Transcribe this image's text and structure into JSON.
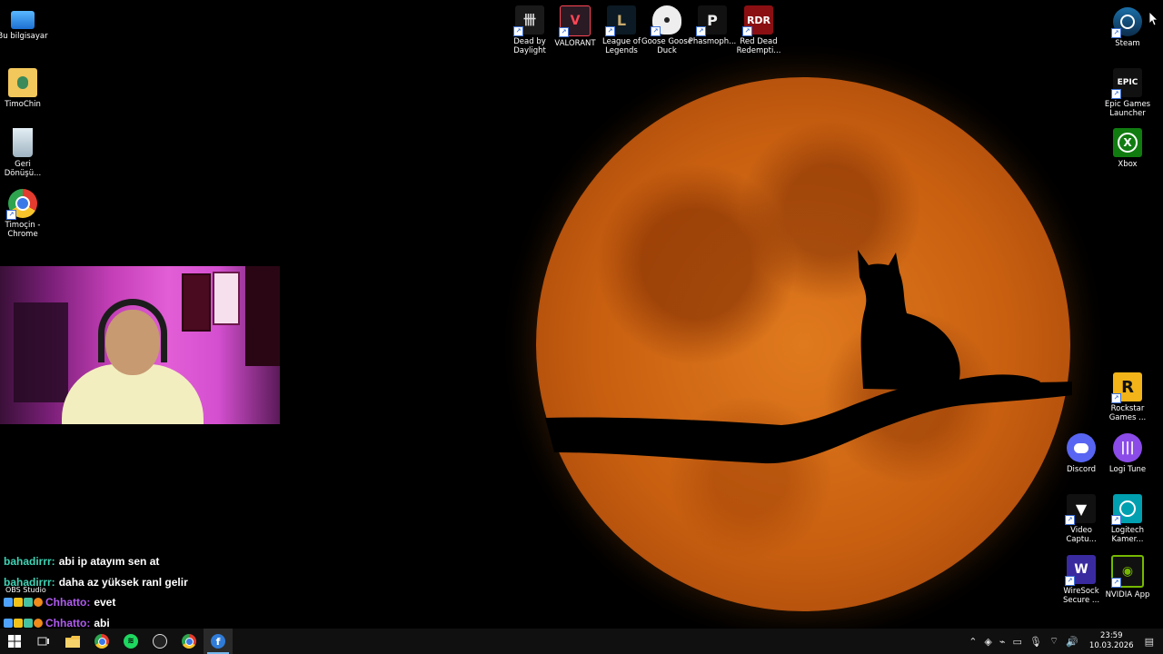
{
  "desktop": {
    "left_icons": [
      {
        "label": "Bu bilgisayar",
        "icon": "computer-icon"
      },
      {
        "label": "TimoChin",
        "icon": "user-folder-icon"
      },
      {
        "label": "Geri Dönüşü...",
        "icon": "recycle-bin-icon"
      },
      {
        "label": "Timoçin - Chrome",
        "icon": "chrome-icon"
      }
    ],
    "top_icons": [
      {
        "label": "Dead by Daylight",
        "icon": "dead-by-daylight-icon"
      },
      {
        "label": "VALORANT",
        "icon": "valorant-icon"
      },
      {
        "label": "League of Legends",
        "icon": "league-of-legends-icon"
      },
      {
        "label": "Goose Goose Duck",
        "icon": "goose-goose-duck-icon"
      },
      {
        "label": "Phasmoph...",
        "icon": "phasmophobia-icon"
      },
      {
        "label": "Red Dead Redempti...",
        "icon": "red-dead-redemption-icon"
      }
    ],
    "right_icons": [
      {
        "label": "Steam",
        "icon": "steam-icon"
      },
      {
        "label": "Epic Games Launcher",
        "icon": "epic-games-icon",
        "glyph": "EPIC"
      },
      {
        "label": "Xbox",
        "icon": "xbox-icon"
      },
      {
        "label": "Rockstar Games ...",
        "icon": "rockstar-icon",
        "glyph": "R"
      },
      {
        "label": "Discord",
        "icon": "discord-icon"
      },
      {
        "label": "Logi Tune",
        "icon": "logi-tune-icon"
      },
      {
        "label": "Video Captu...",
        "icon": "video-capture-icon"
      },
      {
        "label": "Logitech Kamer...",
        "icon": "logitech-camera-icon"
      },
      {
        "label": "WireSock Secure ...",
        "icon": "wiresock-icon"
      },
      {
        "label": "NVIDIA App",
        "icon": "nvidia-icon"
      }
    ]
  },
  "obs_label": "OBS Studio",
  "chat": {
    "messages": [
      {
        "user": "bahadirrr:",
        "text": "abi ip atayım sen at",
        "color": "#3fd3b5"
      },
      {
        "user": "bahadirrr:",
        "text": "daha az yüksek ranl gelir",
        "color": "#3fd3b5"
      },
      {
        "user": "Chhatto:",
        "text": "evet",
        "color": "#b05cf0"
      },
      {
        "user": "Chhatto:",
        "text": "abi",
        "color": "#b05cf0"
      }
    ]
  },
  "taskbar": {
    "apps": [
      {
        "name": "start-button",
        "icon": "windows-icon"
      },
      {
        "name": "task-view-button",
        "icon": "task-view-icon"
      },
      {
        "name": "file-explorer-button",
        "icon": "folder-icon"
      },
      {
        "name": "chrome-button",
        "icon": "chrome-icon"
      },
      {
        "name": "spotify-button",
        "icon": "spotify-icon"
      },
      {
        "name": "obs-button",
        "icon": "obs-icon"
      },
      {
        "name": "chrome-profile-button",
        "icon": "chrome-icon"
      },
      {
        "name": "fluent-app-button",
        "icon": "app-f-icon",
        "glyph": "f"
      }
    ],
    "clock_time": "23:59",
    "clock_date": "10.03.2026"
  },
  "colors": {
    "moon": "#d46a18",
    "taskbar": "#101010",
    "accent": "#76b9ed"
  }
}
